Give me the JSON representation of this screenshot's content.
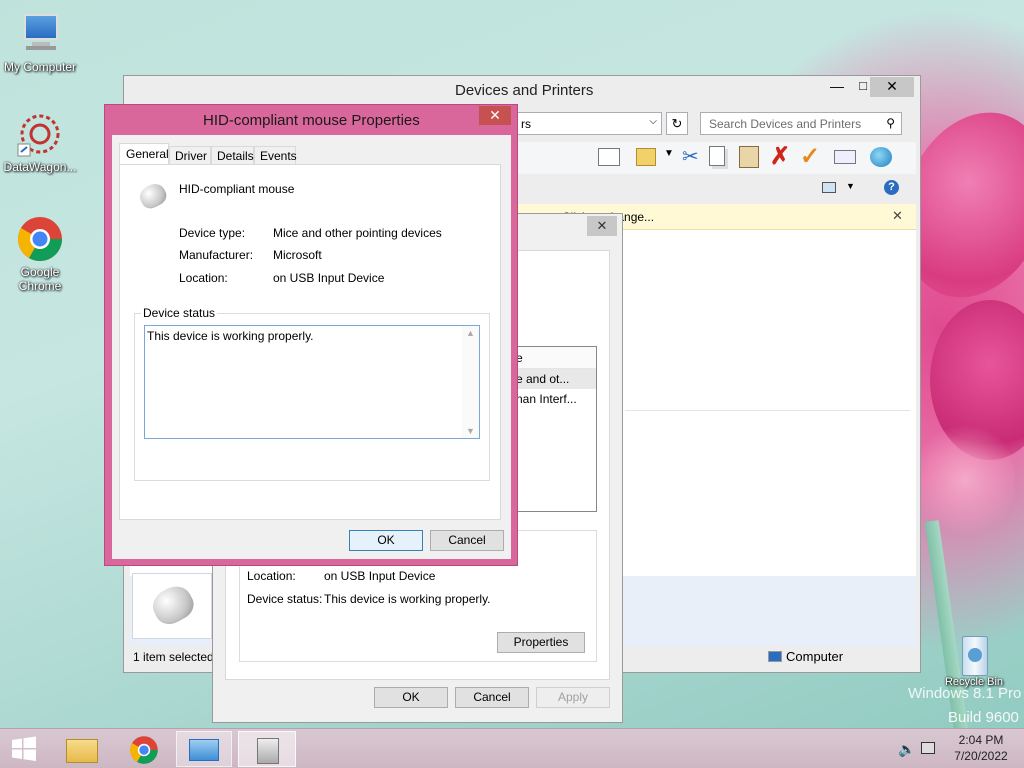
{
  "desktop": {
    "icons": [
      {
        "label": "My Computer"
      },
      {
        "label": "DataWagon..."
      },
      {
        "label": "Google Chrome"
      },
      {
        "label": "Recycle Bin"
      }
    ],
    "watermark": {
      "line1": "Windows 8.1 Pro",
      "line2": "Build 9600"
    }
  },
  "devices_window": {
    "title": "Devices and Printers",
    "address_tail": "rs",
    "search_placeholder": "Search Devices and Printers",
    "info_bar_text": "Click to change...",
    "status_selected": "1 item selected",
    "status_computer": "Computer"
  },
  "back_props": {
    "col_header": "e",
    "row1": "e and ot...",
    "row2": "nan Interf...",
    "location_label": "Location:",
    "location_value": "on USB Input Device",
    "status_label": "Device status:",
    "status_value": "This device is working properly.",
    "properties_button": "Properties",
    "ok": "OK",
    "cancel": "Cancel",
    "apply": "Apply"
  },
  "mouse_props": {
    "title": "HID-compliant mouse Properties",
    "tabs": [
      "General",
      "Driver",
      "Details",
      "Events"
    ],
    "device_name": "HID-compliant mouse",
    "device_type_label": "Device type:",
    "device_type_value": "Mice and other pointing devices",
    "manufacturer_label": "Manufacturer:",
    "manufacturer_value": "Microsoft",
    "location_label": "Location:",
    "location_value": "on USB Input Device",
    "status_group": "Device status",
    "status_text": "This device is working properly.",
    "ok": "OK",
    "cancel": "Cancel"
  },
  "taskbar": {
    "time": "2:04 PM",
    "date": "7/20/2022"
  },
  "colors": {
    "accent_frame": "#d9679c",
    "close_red": "#c75050",
    "default_button": "#3c7fb1"
  }
}
